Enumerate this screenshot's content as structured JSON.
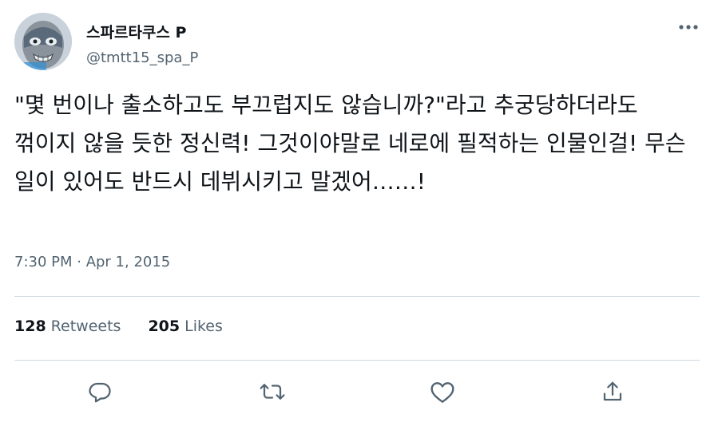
{
  "author": {
    "display_name": "스파르타쿠스 P",
    "handle": "@tmtt15_spa_P",
    "avatar_icon": "masked-character-avatar"
  },
  "tweet": {
    "text": "\"몇 번이나 출소하고도 부끄럽지도 않습니까?\"라고 추궁당하더라도 꺾이지 않을 듯한 정신력! 그것이야말로 네로에 필적하는 인물인걸! 무슨 일이 있어도 반드시 데뷔시키고 말겠어……!",
    "timestamp": "7:30 PM · Apr 1, 2015"
  },
  "stats": {
    "retweets_count": "128",
    "retweets_label": "Retweets",
    "likes_count": "205",
    "likes_label": "Likes"
  },
  "actions": [
    "reply-icon",
    "retweet-icon",
    "like-icon",
    "share-icon"
  ],
  "colors": {
    "text_primary": "#0f1419",
    "text_secondary": "#536471",
    "divider": "#cfd9de"
  }
}
